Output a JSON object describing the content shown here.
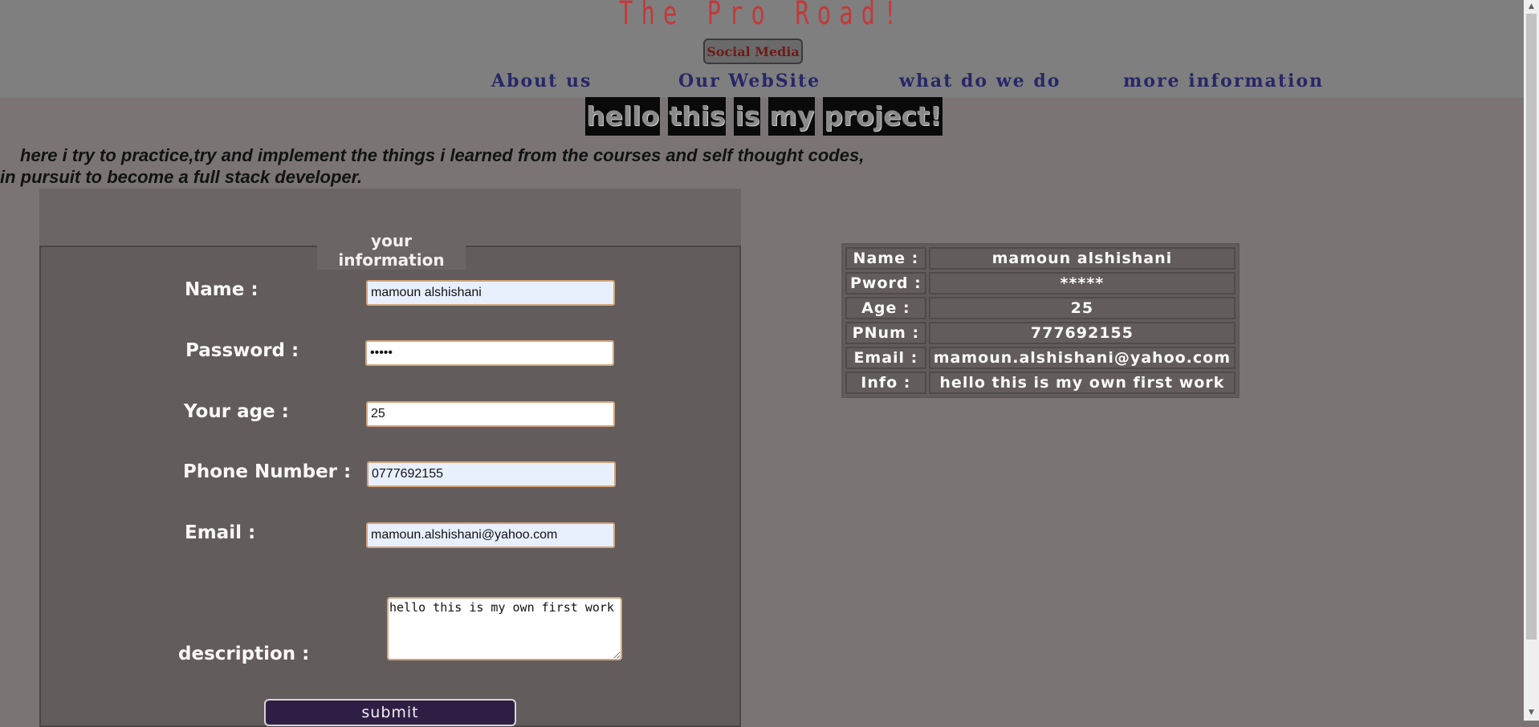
{
  "header": {
    "title": "The Pro Road!",
    "social_button": "Social Media",
    "nav": [
      "About us",
      "Our WebSite",
      "what do we do",
      "more information"
    ]
  },
  "banner": {
    "words": [
      "hello",
      "this",
      "is",
      "my",
      "project!"
    ]
  },
  "intro": {
    "line1": "here i try to practice,try and implement the things i learned from the courses and self thought codes,",
    "line2": "in pursuit to become a full stack developer."
  },
  "form": {
    "legend": "your information",
    "labels": {
      "name": "Name :",
      "password": "Password :",
      "age": "Your age :",
      "phone": "Phone Number :",
      "email": "Email :",
      "description": "description :"
    },
    "values": {
      "name": "mamoun alshishani",
      "password": "•••••",
      "age": "25",
      "phone": "0777692155",
      "email": "mamoun.alshishani@yahoo.com",
      "description": "hello this is my own first work"
    },
    "submit_label": "submit"
  },
  "info_table": {
    "rows": [
      {
        "key": "Name :",
        "value": "mamoun alshishani"
      },
      {
        "key": "Pword :",
        "value": "*****"
      },
      {
        "key": "Age :",
        "value": "25"
      },
      {
        "key": "PNum :",
        "value": "777692155"
      },
      {
        "key": "Email :",
        "value": "mamoun.alshishani@yahoo.com"
      },
      {
        "key": "Info :",
        "value": "hello this is my own first work"
      }
    ]
  },
  "colors": {
    "page_background": "#7a7574",
    "header_background": "#7f7f7f",
    "title": "#c23a3a",
    "nav": "#272768",
    "submit_button": "#2f1e44",
    "input_border": "#d3a57d"
  }
}
